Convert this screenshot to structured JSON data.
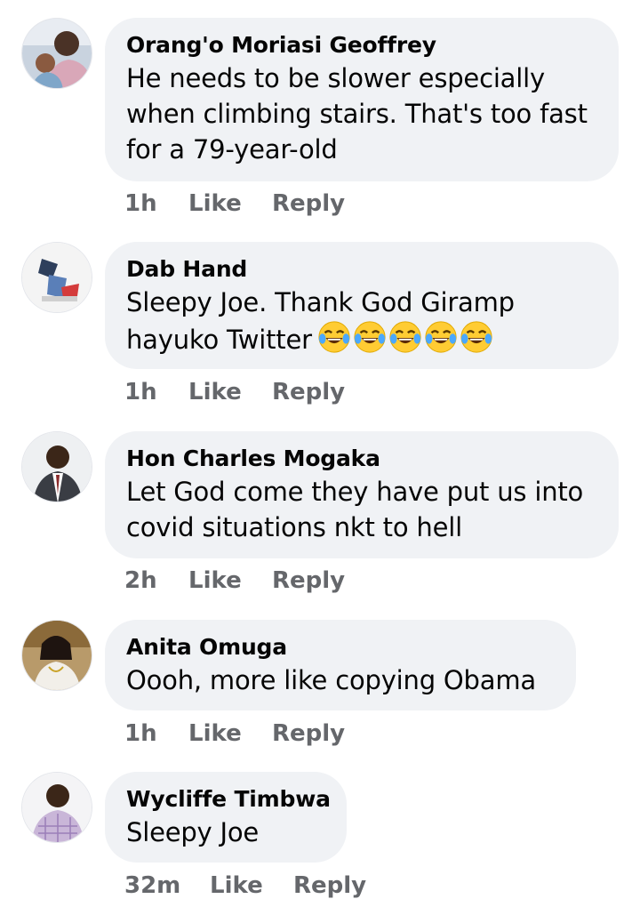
{
  "comments": [
    {
      "author": "Orang'o Moriasi Geoffrey",
      "text_lines": [
        "He needs to be slower especially",
        "when climbing stairs. That's too fast",
        "for a 79-year-old"
      ],
      "time": "1h",
      "like_label": "Like",
      "reply_label": "Reply"
    },
    {
      "author": "Dab Hand",
      "text_lines": [
        "Sleepy Joe. Thank God Giramp",
        "hayuko Twitter"
      ],
      "emoji": "😂😂😂😂😂",
      "time": "1h",
      "like_label": "Like",
      "reply_label": "Reply"
    },
    {
      "author": "Hon Charles Mogaka",
      "text_lines": [
        "Let God come they have put us into",
        "covid situations nkt to hell"
      ],
      "time": "2h",
      "like_label": "Like",
      "reply_label": "Reply"
    },
    {
      "author": "Anita Omuga",
      "text_lines": [
        "Oooh, more like copying Obama"
      ],
      "time": "1h",
      "like_label": "Like",
      "reply_label": "Reply"
    },
    {
      "author": "Wycliffe Timbwa",
      "text_lines": [
        "Sleepy Joe"
      ],
      "time": "32m",
      "like_label": "Like",
      "reply_label": "Reply"
    }
  ],
  "colors": {
    "bubble": "#f0f2f5",
    "meta_text": "#65676b",
    "body_text": "#050505"
  }
}
